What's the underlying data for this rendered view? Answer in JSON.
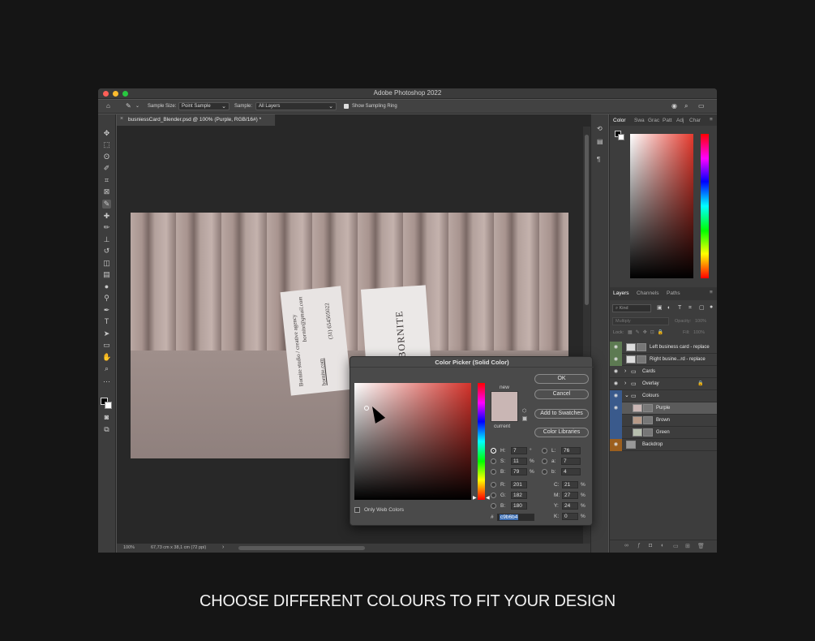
{
  "app": {
    "title": "Adobe Photoshop 2022"
  },
  "options_bar": {
    "sample_size_label": "Sample Size:",
    "sample_size_value": "Point Sample",
    "sample_label": "Sample:",
    "sample_value": "All Layers",
    "show_sampling_ring": "Show Sampling Ring"
  },
  "document": {
    "tab_title": "busniessCard_Blender.psd @ 100% (Purple, RGB/16#) *",
    "zoom": "100%",
    "doc_info": "67,73 cm x 38,1 cm (72 ppi)"
  },
  "artwork": {
    "card1_line1": "Bornite studio / creative agency",
    "card1_line2": "bornite@gmail.com",
    "card1_phone": "(31) 654505022",
    "card1_web": "bornite.com",
    "card2_word": "BORNITE"
  },
  "color_picker": {
    "title": "Color Picker (Solid Color)",
    "new_label": "new",
    "current_label": "current",
    "ok": "OK",
    "cancel": "Cancel",
    "add_to_swatches": "Add to Swatches",
    "color_libraries": "Color Libraries",
    "h": "7",
    "s": "11",
    "b": "79",
    "r": "201",
    "g": "182",
    "b_rgb": "180",
    "l": "76",
    "a": "7",
    "lab_b": "4",
    "c": "21",
    "m": "27",
    "y": "24",
    "k": "0",
    "hex": "c9b6b4",
    "only_web_colors": "Only Web Colors",
    "deg": "°",
    "pct": "%",
    "hash": "#",
    "lbl_h": "H:",
    "lbl_s": "S:",
    "lbl_b": "B:",
    "lbl_r": "R:",
    "lbl_g": "G:",
    "lbl_b2": "B:",
    "lbl_l": "L:",
    "lbl_a": "a:",
    "lbl_lb": "b:",
    "lbl_c": "C:",
    "lbl_m": "M:",
    "lbl_y": "Y:",
    "lbl_k": "K:"
  },
  "color_panel": {
    "tabs": [
      "Color",
      "Swa",
      "Grac",
      "Patt",
      "Adj",
      "Char"
    ]
  },
  "layers_panel": {
    "tabs": [
      "Layers",
      "Channels",
      "Paths"
    ],
    "kind_placeholder": "Kind",
    "blend_mode": "Multiply",
    "opacity_label": "Opacity:",
    "opacity_value": "100%",
    "lock_label": "Lock:",
    "fill_label": "Fill:",
    "fill_value": "100%",
    "layers": [
      {
        "name": "Left business card - replace"
      },
      {
        "name": "Right busine...rd - replace"
      },
      {
        "name": "Cards"
      },
      {
        "name": "Overlay"
      },
      {
        "name": "Colours"
      },
      {
        "name": "Purple"
      },
      {
        "name": "Brown"
      },
      {
        "name": "Green"
      },
      {
        "name": "Backdrop"
      }
    ]
  },
  "colors": {
    "selected": "#c9b6b4",
    "accent_blue": "#3a5a8c"
  },
  "caption": "CHOOSE DIFFERENT COLOURS TO FIT YOUR DESIGN"
}
